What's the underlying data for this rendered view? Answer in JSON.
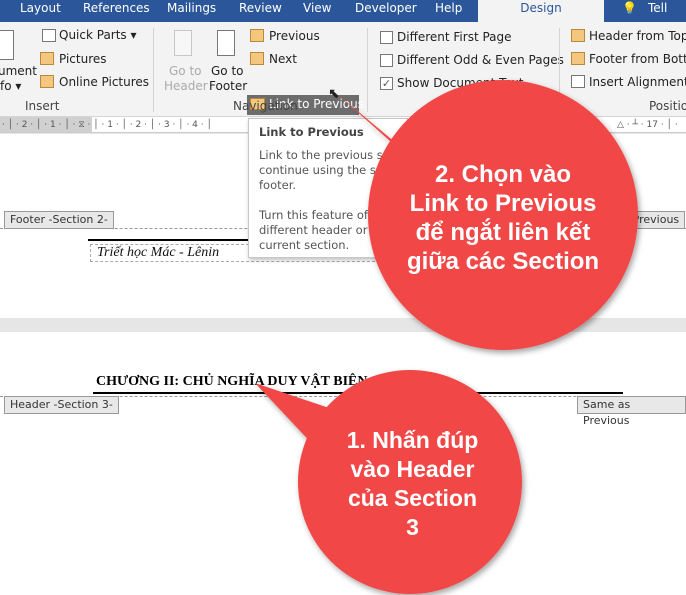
{
  "tabs": [
    "Layout",
    "References",
    "Mailings",
    "Review",
    "View",
    "Developer",
    "Help",
    "Design",
    "Tell me"
  ],
  "ribbon": {
    "document_info": [
      "ument",
      "fo ▾"
    ],
    "quick_parts": "Quick Parts ▾",
    "pictures": "Pictures",
    "online_pictures": "Online Pictures",
    "insert_group": "Insert",
    "go_to_header": [
      "Go to",
      "Header"
    ],
    "go_to_footer": [
      "Go to",
      "Footer"
    ],
    "previous": "Previous",
    "next": "Next",
    "link_to_previous": "Link to Previous",
    "navigation_group": "Navigation",
    "different_first_page": "Different First Page",
    "different_odd_even": "Different Odd & Even Pages",
    "show_document_text": "Show Document Text",
    "show_document_text_checked": true,
    "header_from_top": "Header from Top:",
    "footer_from_bottom": "Footer from Bottom",
    "insert_alignment_tab": "Insert Alignment T",
    "position_group": "Position"
  },
  "ruler": "· │ · 2 · │ · 1 · │ · ⧖ · │ · 1 · │ · 2 · │ · 3 · │ · 4 · │",
  "ruler_right": "△ · ┴ · 17 · │ ·",
  "tooltip": {
    "title": "Link to Previous",
    "lines": [
      "Link to the previous s",
      "continue using the sa",
      "footer.",
      "",
      "Turn this feature off",
      "different header or fo",
      "current section."
    ]
  },
  "page1": {
    "footer_label": "Footer -Section 2-",
    "same_as_previous": "Same as Previous",
    "footer_text": "Triết học Mác - Lênin"
  },
  "page2": {
    "header_text": "CHƯƠNG II: CHỦ NGHĨA DUY VẬT BIỆN CHỨNG",
    "header_label": "Header -Section 3-",
    "same_as_previous": "Same as Previous"
  },
  "callouts": {
    "step1": [
      "1. Nhấn đúp",
      "vào Header",
      "của Section",
      "3"
    ],
    "step2": [
      "2. Chọn vào",
      "Link to Previous",
      "để ngắt liên kết",
      "giữa các Section"
    ],
    "color": "#f24646"
  }
}
